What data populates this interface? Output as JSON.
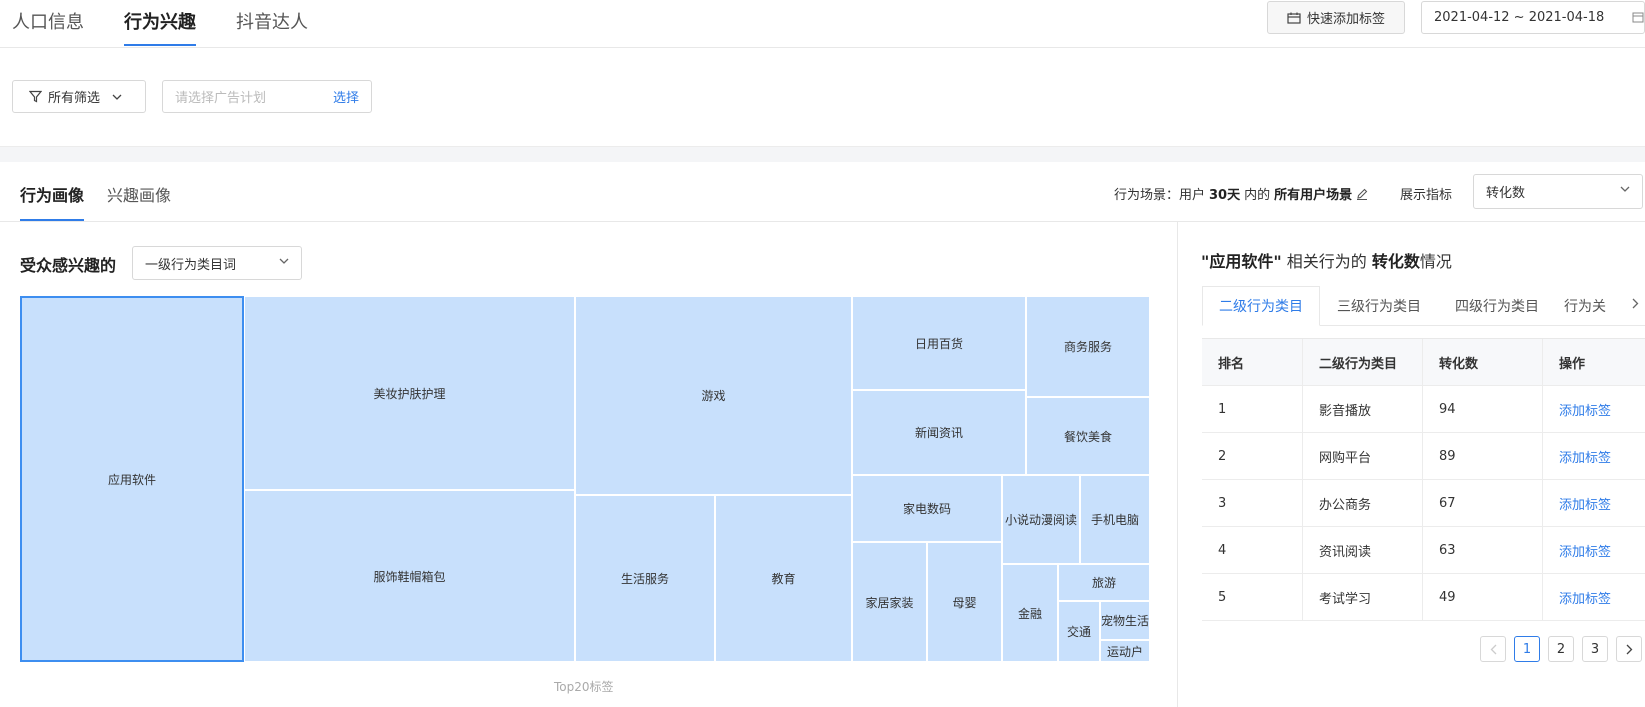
{
  "top_tabs": [
    {
      "label": "人口信息"
    },
    {
      "label": "行为兴趣"
    },
    {
      "label": "抖音达人"
    }
  ],
  "quick_tag_button": "快速添加标签",
  "date_range": "2021-04-12 ~ 2021-04-18",
  "filter": {
    "all_filters_label": "所有筛选",
    "plan_placeholder": "请选择广告计划",
    "select_link": "选择"
  },
  "section_tabs": [
    {
      "label": "行为画像"
    },
    {
      "label": "兴趣画像"
    }
  ],
  "scene": {
    "prefix": "行为场景：用户",
    "days": "30天",
    "mid": "内的",
    "value": "所有用户场景"
  },
  "metric": {
    "label": "展示指标",
    "selected": "转化数"
  },
  "interest": {
    "title": "受众感兴趣的",
    "level_selected": "一级行为类目词"
  },
  "treemap": {
    "caption": "Top20标签",
    "cells": [
      {
        "label": "应用软件"
      },
      {
        "label": "美妆护肤护理"
      },
      {
        "label": "服饰鞋帽箱包"
      },
      {
        "label": "游戏"
      },
      {
        "label": "生活服务"
      },
      {
        "label": "教育"
      },
      {
        "label": "日用百货"
      },
      {
        "label": "商务服务"
      },
      {
        "label": "新闻资讯"
      },
      {
        "label": "餐饮美食"
      },
      {
        "label": "家电数码"
      },
      {
        "label": "小说动漫阅读"
      },
      {
        "label": "手机电脑"
      },
      {
        "label": "家居家装"
      },
      {
        "label": "母婴"
      },
      {
        "label": "金融"
      },
      {
        "label": "旅游"
      },
      {
        "label": "交通"
      },
      {
        "label": "宠物生活"
      },
      {
        "label": "运动户"
      }
    ]
  },
  "right_panel": {
    "title_open": "\"应用软件\"",
    "title_mid": " 相关行为的 ",
    "title_metric": "转化数",
    "title_end": "情况",
    "sub_tabs": [
      {
        "label": "二级行为类目"
      },
      {
        "label": "三级行为类目"
      },
      {
        "label": "四级行为类目"
      },
      {
        "label": "行为关"
      }
    ],
    "table": {
      "headers": [
        "排名",
        "二级行为类目",
        "转化数",
        "操作"
      ],
      "rows": [
        {
          "rank": "1",
          "category": "影音播放",
          "value": "94",
          "action": "添加标签"
        },
        {
          "rank": "2",
          "category": "网购平台",
          "value": "89",
          "action": "添加标签"
        },
        {
          "rank": "3",
          "category": "办公商务",
          "value": "67",
          "action": "添加标签"
        },
        {
          "rank": "4",
          "category": "资讯阅读",
          "value": "63",
          "action": "添加标签"
        },
        {
          "rank": "5",
          "category": "考试学习",
          "value": "49",
          "action": "添加标签"
        }
      ]
    },
    "pager": {
      "pages": [
        "1",
        "2",
        "3"
      ],
      "current": "1"
    }
  }
}
